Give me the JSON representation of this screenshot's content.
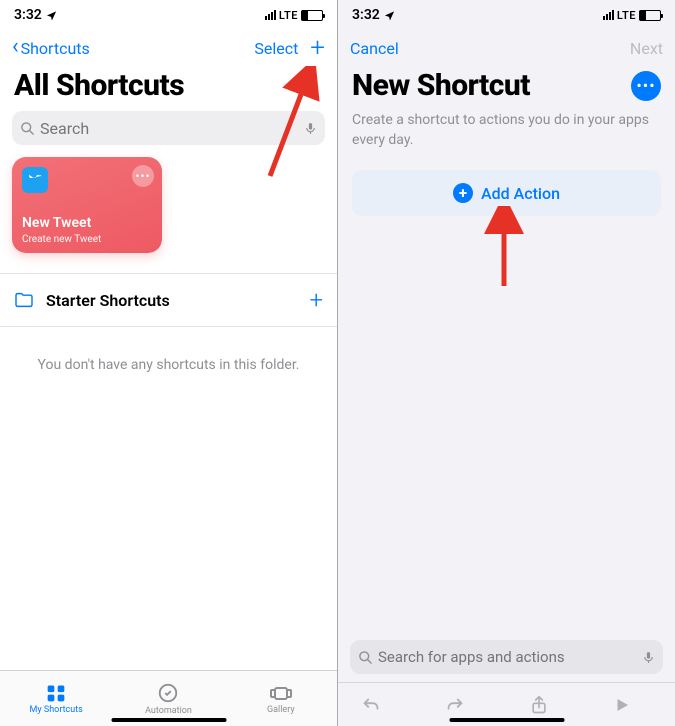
{
  "status": {
    "time": "3:32",
    "network": "LTE"
  },
  "left": {
    "nav_back": "Shortcuts",
    "nav_select": "Select",
    "title": "All Shortcuts",
    "search_placeholder": "Search",
    "card": {
      "title": "New Tweet",
      "subtitle": "Create new Tweet"
    },
    "folder": {
      "name": "Starter Shortcuts"
    },
    "empty_text": "You don't have any shortcuts in this folder.",
    "tabs": {
      "my_shortcuts": "My Shortcuts",
      "automation": "Automation",
      "gallery": "Gallery"
    }
  },
  "right": {
    "nav_cancel": "Cancel",
    "nav_next": "Next",
    "title": "New Shortcut",
    "subtitle": "Create a shortcut to actions you do in your apps every day.",
    "add_action": "Add Action",
    "search_placeholder": "Search for apps and actions"
  }
}
